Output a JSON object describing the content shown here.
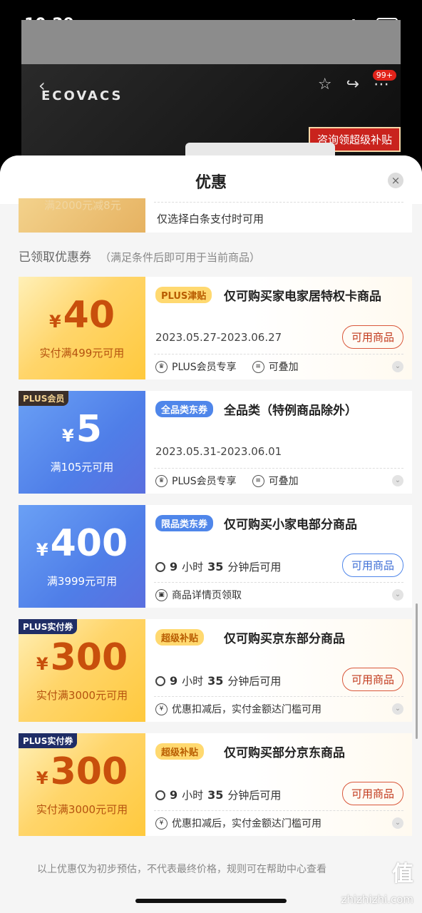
{
  "status": {
    "time": "10:29"
  },
  "hero": {
    "logo": "ECOVACS",
    "badge": "99+",
    "consult": "咨询领超级补贴"
  },
  "sheet": {
    "title": "优惠",
    "close": "×",
    "partial_left": "满2000元减8元",
    "partial_text": "仅选择白条支付时可用",
    "section_label": "已领取优惠券",
    "section_sub": "（满足条件后即可用于当前商品）",
    "footer_note": "以上优惠仅为初步预估，不代表最终价格，规则可在帮助中心查看"
  },
  "coupons": [
    {
      "yen": "¥",
      "amount": "40",
      "cond": "实付满499元可用",
      "tag": "PLUS津贴",
      "title": "仅可购买家电家居特权卡商品",
      "date": "2023.05.27-2023.06.27",
      "button": "可用商品",
      "meta1": "PLUS会员专享",
      "meta2": "可叠加"
    },
    {
      "corner": "PLUS会员",
      "yen": "¥",
      "amount": "5",
      "cond": "满105元可用",
      "tag": "全品类东券",
      "title": "全品类（特例商品除外）",
      "date": "2023.05.31-2023.06.01",
      "meta1": "PLUS会员专享",
      "meta2": "可叠加"
    },
    {
      "yen": "¥",
      "amount": "400",
      "cond": "满3999元可用",
      "tag": "限品类东券",
      "title": "仅可购买小家电部分商品",
      "time_hours": "9",
      "time_h_unit": "小时",
      "time_mins": "35",
      "time_rest": "分钟后可用",
      "button": "可用商品",
      "meta1": "商品详情页领取"
    },
    {
      "corner": "PLUS实付券",
      "yen": "¥",
      "amount": "300",
      "cond": "实付满3000元可用",
      "tag": "超级补贴",
      "title": "仅可购买京东部分商品",
      "time_hours": "9",
      "time_h_unit": "小时",
      "time_mins": "35",
      "time_rest": "分钟后可用",
      "button": "可用商品",
      "meta1": "优惠扣减后，实付金额达门槛可用"
    },
    {
      "corner": "PLUS实付券",
      "yen": "¥",
      "amount": "300",
      "cond": "实付满3000元可用",
      "tag": "超级补贴",
      "title": "仅可购买部分京东商品",
      "time_hours": "9",
      "time_h_unit": "小时",
      "time_mins": "35",
      "time_rest": "分钟后可用",
      "button": "可用商品",
      "meta1": "优惠扣减后，实付金额达门槛可用"
    }
  ],
  "watermark": {
    "logo": "值",
    "site": "zhizhizhi.com"
  },
  "colors": {
    "gold": "#ffc93d",
    "blue": "#4f7ee8",
    "accent_red": "#c23b1e"
  }
}
